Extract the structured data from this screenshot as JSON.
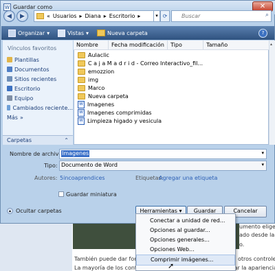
{
  "window": {
    "title": "Guardar como",
    "close_glyph": "✕"
  },
  "address": {
    "breadcrumb": [
      "«",
      "Usuarios",
      "Diana",
      "Escritorio"
    ],
    "search_placeholder": "Buscar"
  },
  "toolbar": {
    "organize": "Organizar",
    "views": "Vistas",
    "new_folder": "Nueva carpeta"
  },
  "sidebar": {
    "heading": "Vínculos favoritos",
    "items": [
      {
        "label": "Plantillas",
        "color": "#e1b54a"
      },
      {
        "label": "Documentos",
        "color": "#4f7fc6"
      },
      {
        "label": "Sitios recientes",
        "color": "#6f8fb8"
      },
      {
        "label": "Escritorio",
        "color": "#3d72c2"
      },
      {
        "label": "Equipo",
        "color": "#7f8fa6"
      },
      {
        "label": "Cambiados reciente...",
        "color": "#6ea0d8"
      },
      {
        "label": "Más",
        "color": "#1c3e78"
      }
    ],
    "folders_label": "Carpetas"
  },
  "filelist": {
    "columns": [
      "Nombre",
      "Fecha modificación",
      "Tipo",
      "Tamaño"
    ],
    "rows": [
      {
        "name": "Aulaclic",
        "kind": "folder"
      },
      {
        "name": "C a j a M a d r i d - Correo Interactivo_fil...",
        "kind": "folder"
      },
      {
        "name": "emozzion",
        "kind": "folder"
      },
      {
        "name": "img",
        "kind": "folder"
      },
      {
        "name": "Marco",
        "kind": "folder"
      },
      {
        "name": "Nueva carpeta",
        "kind": "folder"
      },
      {
        "name": "Imagenes",
        "kind": "doc"
      },
      {
        "name": "Imagenes comprimidas",
        "kind": "doc"
      },
      {
        "name": "Limpieza higado y vesicula",
        "kind": "doc"
      }
    ]
  },
  "form": {
    "filename_label": "Nombre de archivo:",
    "filename_value": "Imagenes",
    "type_label": "Tipo:",
    "type_value": "Documento de Word",
    "authors_label": "Autores:",
    "authors_value": "5incoaprendices",
    "tags_label": "Etiquetas:",
    "tags_value": "Agregar una etiqueta",
    "thumbnail_label": "Guardar miniatura"
  },
  "footer": {
    "hide_folders": "Ocultar carpetas",
    "tools": "Herramientas",
    "save": "Guardar",
    "cancel": "Cancelar"
  },
  "menu": {
    "items": [
      "Conectar a unidad de red...",
      "Opciones al guardar...",
      "Opciones generales...",
      "Opciones Web...",
      "Comprimir imágenes..."
    ],
    "highlighted_index": 4
  },
  "document": {
    "right_text_1": "umento eligen",
    "right_text_2": "ado desde la ga",
    "right_text_3": "o.",
    "line_1_left": "También puede dar for",
    "line_1_right": "otros controle",
    "line_2": "La mayoría de los controles ofrecen la posibilidad de utilizar la apariencia de"
  }
}
